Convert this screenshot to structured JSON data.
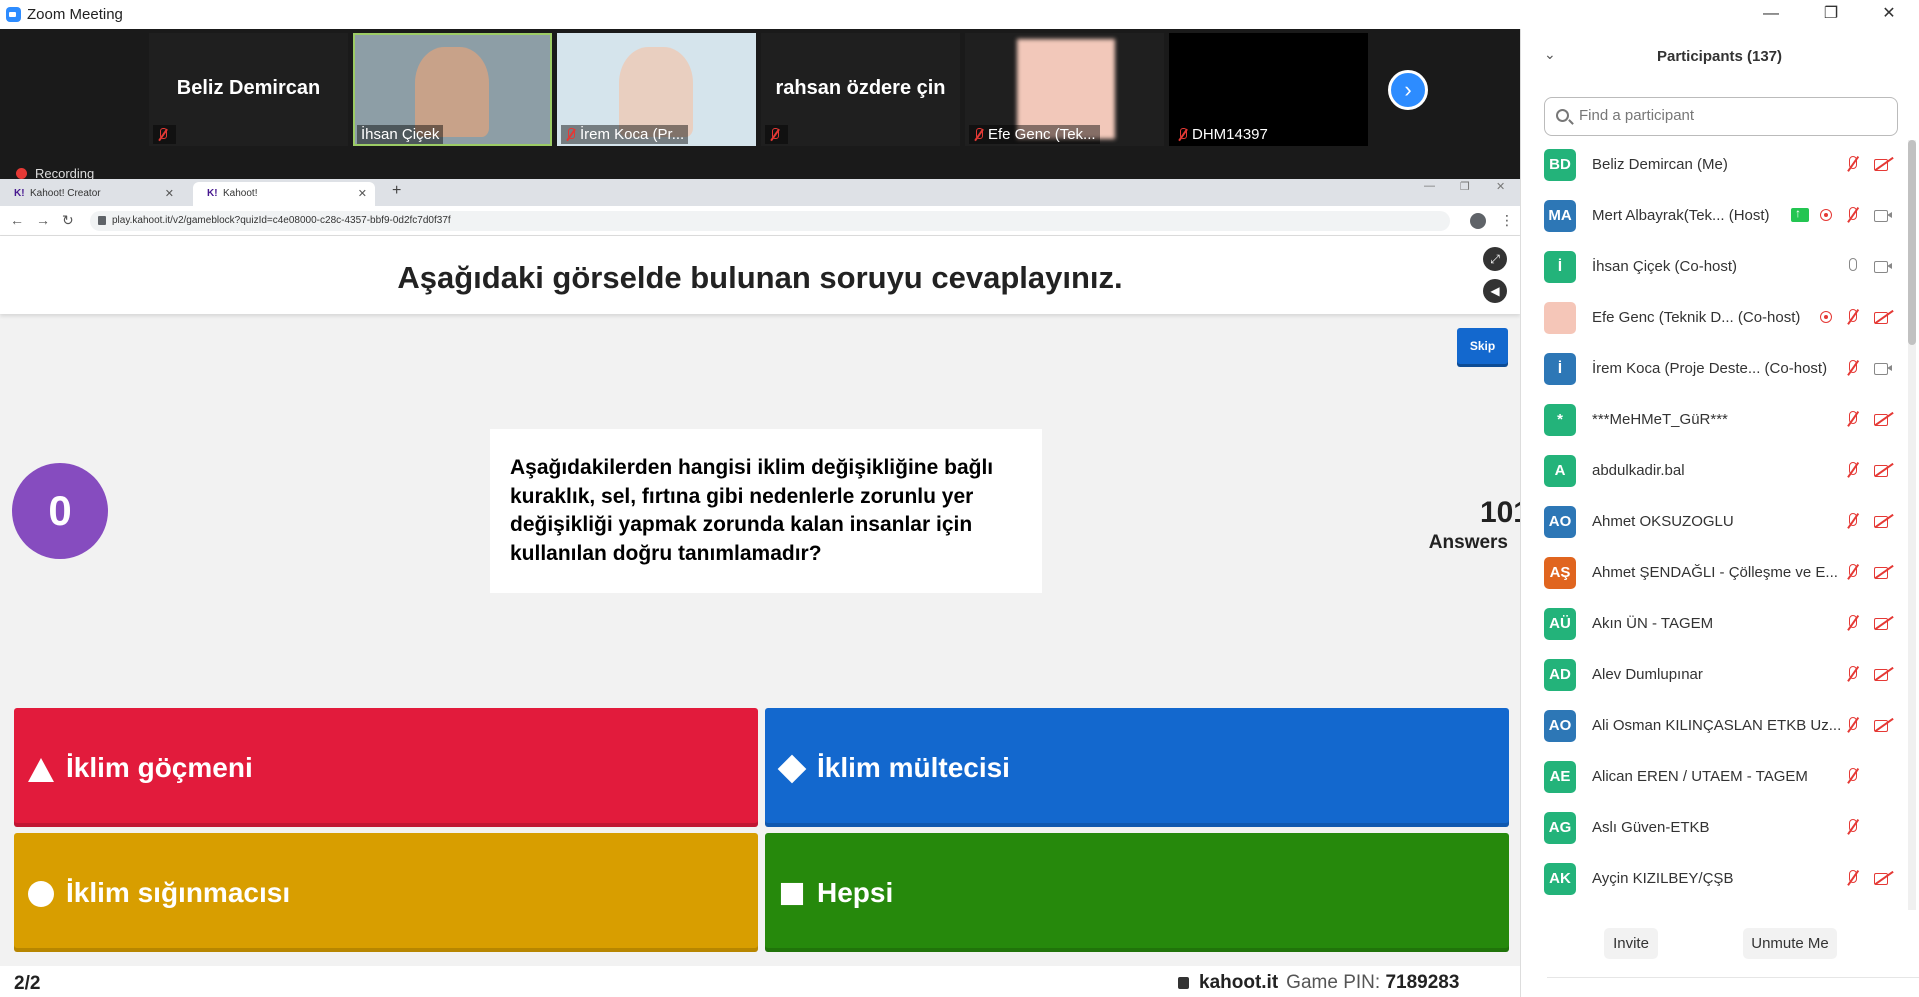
{
  "window": {
    "title": "Zoom Meeting",
    "min": "—",
    "max": "❐",
    "close": "✕"
  },
  "video": {
    "tiles": [
      {
        "name": "Beliz Demircan",
        "label": "",
        "center": true,
        "muted": true,
        "bg": "#1f1f1f"
      },
      {
        "name": "İhsan Çiçek",
        "label": "İhsan Çiçek",
        "center": false,
        "muted": false,
        "bg": "#8d9ea6",
        "selected": true
      },
      {
        "name": "İrem Koca (Pr...",
        "label": "İrem Koca (Pr...",
        "center": false,
        "muted": true,
        "bg": "#d5e4ec"
      },
      {
        "name": "rahsan özdere çin",
        "label": "",
        "center": true,
        "muted": true,
        "bg": "#1f1f1f"
      },
      {
        "name": "Efe Genc (Tek...",
        "label": "Efe Genc (Tek...",
        "center": false,
        "muted": true,
        "bg": "#1f1f1f"
      },
      {
        "name": "DHM14397",
        "label": "DHM14397",
        "center": false,
        "muted": true,
        "bg": "#000000"
      }
    ],
    "next_icon": "chevron-right-icon",
    "recording": "Recording"
  },
  "browser": {
    "tabs": [
      {
        "favicon": "K!",
        "title": "Kahoot! Creator"
      },
      {
        "favicon": "K!",
        "title": "Kahoot!"
      }
    ],
    "new_tab": "+",
    "url": "play.kahoot.it/v2/gameblock?quizId=c4e08000-c28c-4357-bbf9-0d2fc7d0f37f",
    "back": "←",
    "forward": "→",
    "reload": "↻",
    "star": "☆",
    "menu": "⋮"
  },
  "kahoot": {
    "title": "Aşağıdaki görselde bulunan soruyu cevaplayınız.",
    "skip": "Skip",
    "timer": "0",
    "question": "Aşağıdakilerden hangisi iklim değişikliğine bağlı kuraklık, sel, fırtına gibi nedenlerle zorunlu yer değişikliği yapmak zorunda kalan insanlar için kullanılan doğru tanımlamadır?",
    "answers_count": "101",
    "answers_label": "Answers",
    "answers": [
      {
        "text": "İklim göçmeni",
        "shape": "triangle",
        "color": "#e21b3c"
      },
      {
        "text": "İklim mültecisi",
        "shape": "diamond",
        "color": "#1368ce"
      },
      {
        "text": "İklim sığınmacısı",
        "shape": "circle",
        "color": "#d89e00"
      },
      {
        "text": "Hepsi",
        "shape": "square",
        "color": "#26890c"
      }
    ],
    "footer": {
      "page": "2/2",
      "site": "kahoot.it",
      "pin_label": "Game PIN:",
      "pin": "7189283"
    }
  },
  "participants": {
    "title": "Participants (137)",
    "search_placeholder": "Find a participant",
    "items": [
      {
        "initials": "BD",
        "color": "#23b37a",
        "name": "Beliz Demircan (Me)",
        "role": "",
        "mic": "off",
        "cam": "off",
        "rec": false,
        "share": false
      },
      {
        "initials": "MA",
        "color": "#2d77b6",
        "name": "Mert Albayrak(Tek...",
        "role": "(Host)",
        "mic": "off",
        "cam": "on",
        "rec": true,
        "share": true
      },
      {
        "initials": "İ",
        "color": "#23b37a",
        "name": "İhsan Çiçek",
        "role": "(Co-host)",
        "mic": "on",
        "cam": "on",
        "rec": false,
        "share": false
      },
      {
        "initials": "",
        "color": "#f5c6b8",
        "name": "Efe Genc (Teknik D...",
        "role": "(Co-host)",
        "mic": "off",
        "cam": "off",
        "rec": true,
        "share": false
      },
      {
        "initials": "İ",
        "color": "#2d77b6",
        "name": "İrem Koca (Proje Deste...",
        "role": "(Co-host)",
        "mic": "off",
        "cam": "on",
        "rec": false,
        "share": false
      },
      {
        "initials": "*",
        "color": "#23b37a",
        "name": "***MeHMeT_GüR***",
        "role": "",
        "mic": "off",
        "cam": "off",
        "rec": false,
        "share": false
      },
      {
        "initials": "A",
        "color": "#23b37a",
        "name": "abdulkadir.bal",
        "role": "",
        "mic": "off",
        "cam": "off",
        "rec": false,
        "share": false
      },
      {
        "initials": "AO",
        "color": "#2d77b6",
        "name": "Ahmet OKSUZOGLU",
        "role": "",
        "mic": "off",
        "cam": "off",
        "rec": false,
        "share": false
      },
      {
        "initials": "AŞ",
        "color": "#e0651f",
        "name": "Ahmet ŞENDAĞLI - Çölleşme ve E...",
        "role": "",
        "mic": "off",
        "cam": "off",
        "rec": false,
        "share": false
      },
      {
        "initials": "AÜ",
        "color": "#23b37a",
        "name": "Akın ÜN - TAGEM",
        "role": "",
        "mic": "off",
        "cam": "off",
        "rec": false,
        "share": false
      },
      {
        "initials": "AD",
        "color": "#23b37a",
        "name": "Alev Dumlupınar",
        "role": "",
        "mic": "off",
        "cam": "off",
        "rec": false,
        "share": false
      },
      {
        "initials": "AO",
        "color": "#2d77b6",
        "name": "Ali Osman KILINÇASLAN ETKB Uz...",
        "role": "",
        "mic": "off",
        "cam": "off",
        "rec": false,
        "share": false
      },
      {
        "initials": "AE",
        "color": "#23b37a",
        "name": "Alican EREN / UTAEM - TAGEM",
        "role": "",
        "mic": "off",
        "cam": "none",
        "rec": false,
        "share": false
      },
      {
        "initials": "AG",
        "color": "#23b37a",
        "name": "Aslı Güven-ETKB",
        "role": "",
        "mic": "off",
        "cam": "none",
        "rec": false,
        "share": false
      },
      {
        "initials": "AK",
        "color": "#23b37a",
        "name": "Ayçin KIZILBEY/ÇŞB",
        "role": "",
        "mic": "off",
        "cam": "off",
        "rec": false,
        "share": false
      }
    ],
    "invite": "Invite",
    "unmute": "Unmute Me"
  }
}
